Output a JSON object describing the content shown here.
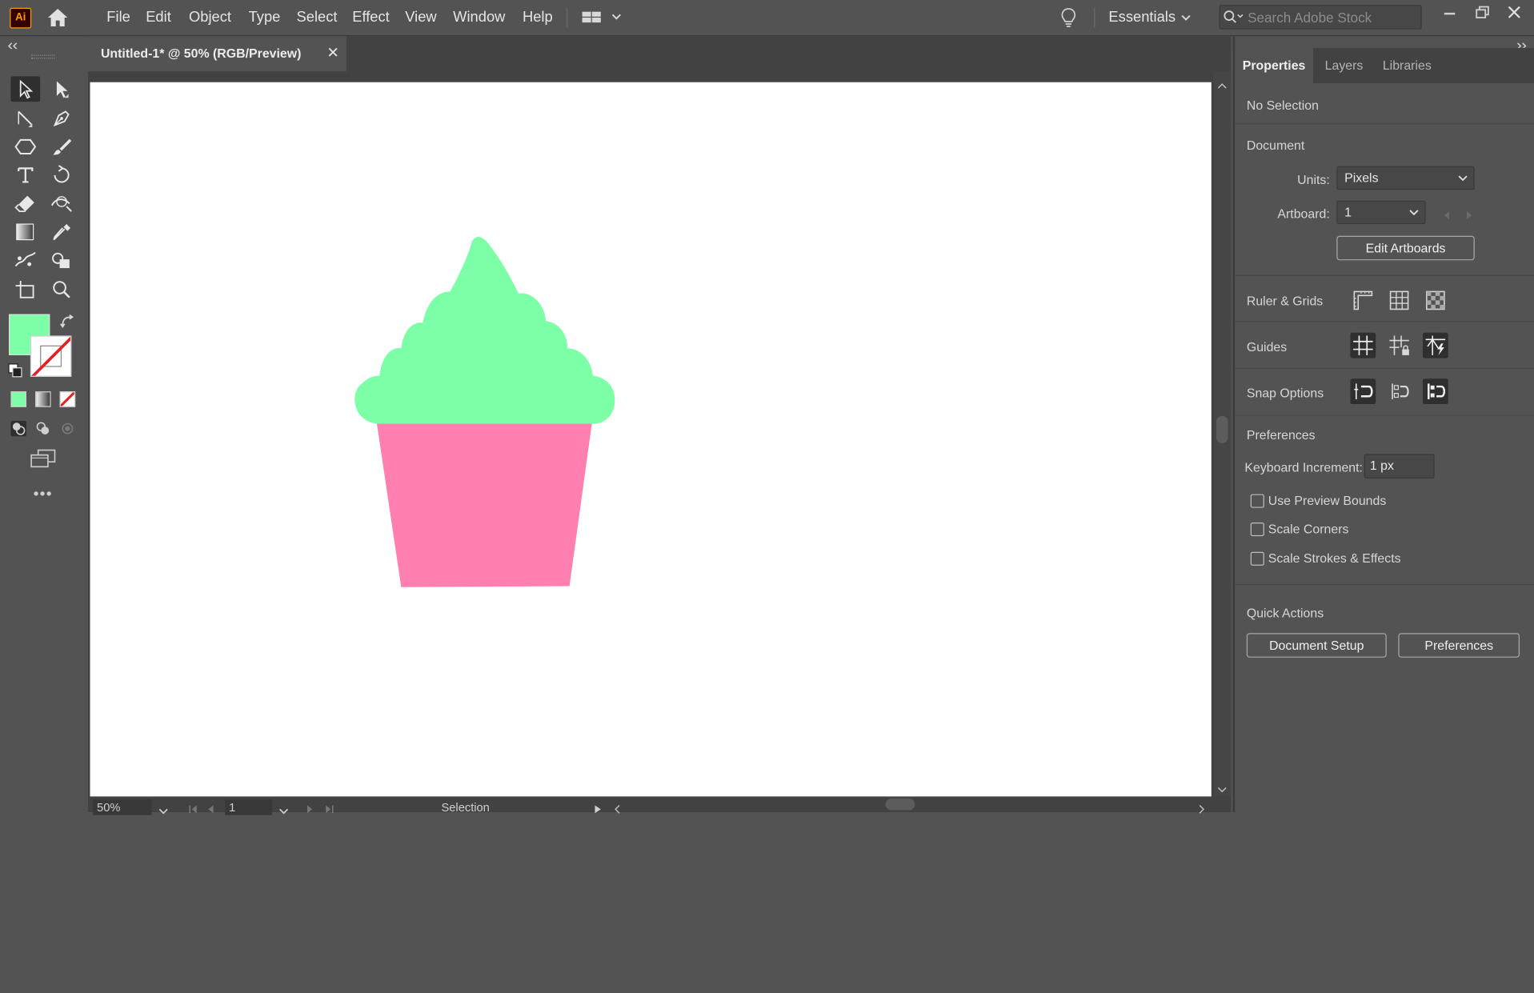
{
  "app": {
    "logo_text": "Ai",
    "menu": [
      "File",
      "Edit",
      "Object",
      "Type",
      "Select",
      "Effect",
      "View",
      "Window",
      "Help"
    ],
    "workspace": "Essentials",
    "stock_search_placeholder": "Search Adobe Stock"
  },
  "document": {
    "tab_title": "Untitled-1* @ 50% (RGB/Preview)",
    "close_glyph": "✕"
  },
  "colors": {
    "fill": "#7dffa8",
    "frosting": "#7dffa8",
    "wrapper": "#ff80b0",
    "artboard": "#ffffff"
  },
  "toolbar": {
    "tools": [
      "selection-tool",
      "direct-selection-tool",
      "line-segment-tool",
      "pen-tool",
      "polygon-tool",
      "paintbrush-tool",
      "type-tool",
      "rotate-tool",
      "eraser-tool",
      "width-tool",
      "gradient-tool",
      "eyedropper-tool",
      "puppet-warp-tool",
      "shape-builder-tool",
      "artboard-tool",
      "zoom-tool"
    ],
    "more_label": "•••"
  },
  "status": {
    "zoom": "50%",
    "artboard_number": "1",
    "tool_name": "Selection"
  },
  "panel": {
    "tabs": [
      "Properties",
      "Layers",
      "Libraries"
    ],
    "selection": "No Selection",
    "document_heading": "Document",
    "units_label": "Units:",
    "units_value": "Pixels",
    "artboard_label": "Artboard:",
    "artboard_value": "1",
    "edit_artboards": "Edit Artboards",
    "ruler_grids": "Ruler & Grids",
    "guides": "Guides",
    "snap_options": "Snap Options",
    "preferences_heading": "Preferences",
    "keyboard_increment_label": "Keyboard Increment:",
    "keyboard_increment_value": "1 px",
    "checkboxes": [
      "Use Preview Bounds",
      "Scale Corners",
      "Scale Strokes & Effects"
    ],
    "quick_actions": "Quick Actions",
    "document_setup": "Document Setup",
    "preferences_button": "Preferences"
  }
}
